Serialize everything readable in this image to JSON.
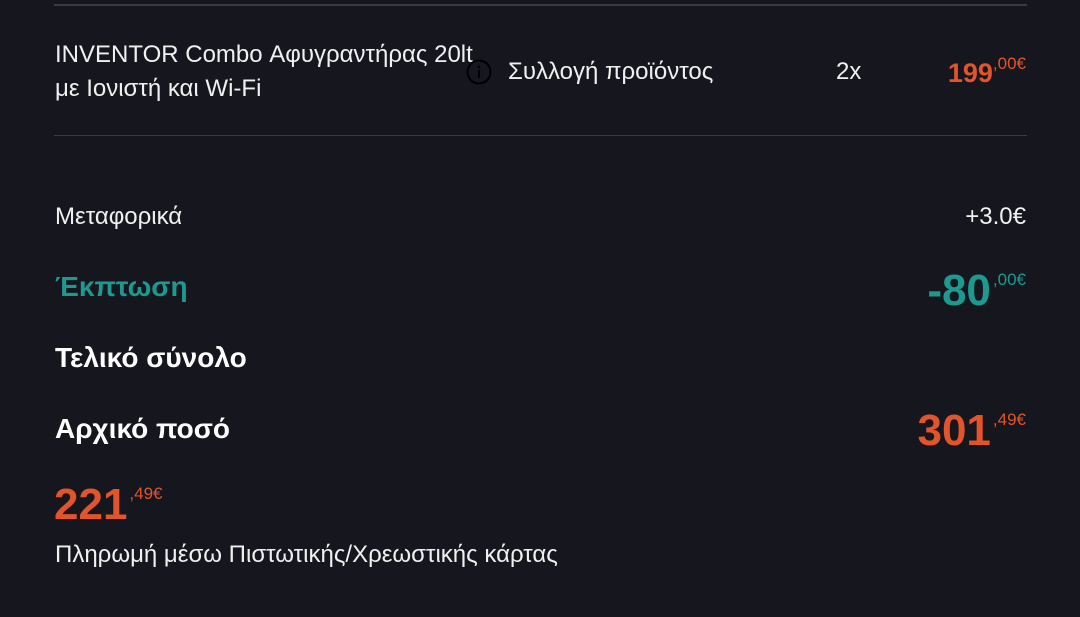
{
  "order_item": {
    "name": "INVENTOR Combo Αφυγραντήρας 20lt με Ιονιστή και Wi-Fi",
    "info_icon": "info-circle-icon",
    "delivery": "Συλλογή προϊόντος",
    "quantity": "2x",
    "price_int": "199",
    "price_dec": ",00€"
  },
  "summary": {
    "shipping_label": "Μεταφορικά",
    "shipping_value": "+3.0€",
    "discount_label": "Έκπτωση",
    "discount_int": "-80",
    "discount_dec": ",00€",
    "total_label": "Τελικό σύνολο",
    "original_label": "Αρχικό ποσό",
    "original_int": "301",
    "original_dec": ",49€",
    "final_int": "221",
    "final_dec": ",49€",
    "payment_method": "Πληρωμή μέσω Πιστωτικής/Χρεωστικής κάρτας"
  },
  "colors": {
    "background": "#16161e",
    "price_orange": "#e2542a",
    "discount_teal": "#1c9a8f",
    "text": "#f0f0f0",
    "divider": "#3a3a42"
  }
}
